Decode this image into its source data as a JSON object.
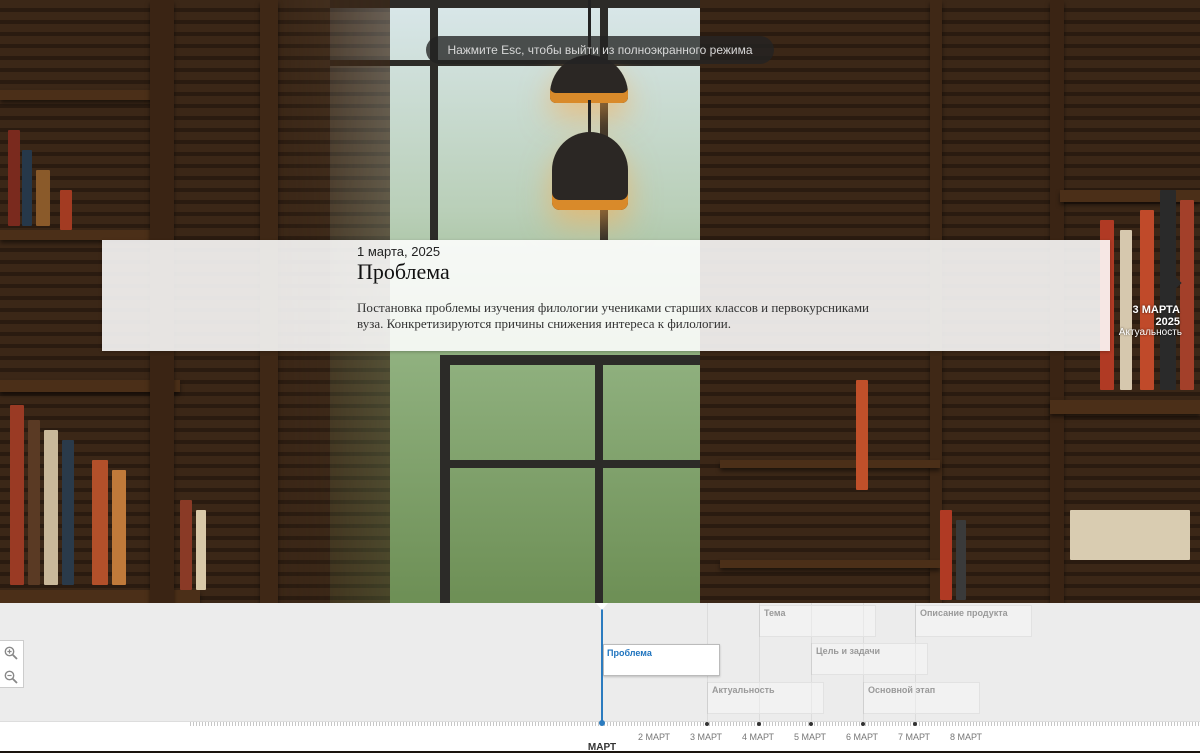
{
  "fullscreen_toast": "Нажмите Esc, чтобы выйти из полноэкранного режима",
  "slide": {
    "date": "1 марта, 2025",
    "title": "Проблема",
    "text": "Постановка проблемы изучения филологии учениками старших классов и первокурсниками вуза. Конкретизируются причины снижения интереса к филологии."
  },
  "next": {
    "date": "3 МАРТА 2025",
    "title": "Актуальность",
    "icon": "chevron-right-icon"
  },
  "timeline": {
    "active_marker": "Проблема",
    "markers": {
      "tema": "Тема",
      "opisanie": "Описание продукта",
      "cel": "Цель и задачи",
      "aktualnost": "Актуальность",
      "osnovnoy": "Основной этап"
    },
    "ticks": [
      "2 МАРТ",
      "3 МАРТ",
      "4 МАРТ",
      "5 МАРТ",
      "6 МАРТ",
      "7 МАРТ",
      "8 МАРТ"
    ],
    "month": "МАРТ",
    "accent_color": "#2b7bbf"
  },
  "zoom": {
    "in_icon": "zoom-in-icon",
    "out_icon": "zoom-out-icon"
  }
}
